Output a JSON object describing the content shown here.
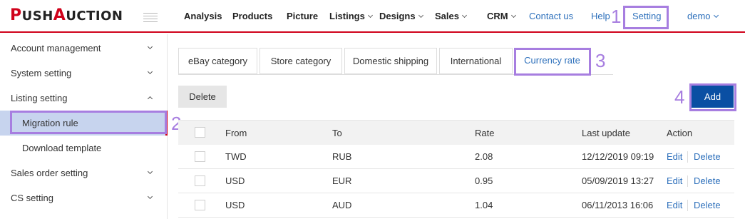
{
  "logo": {
    "p1": "P",
    "p2": "USH",
    "p3": "A",
    "p4": "UCTION"
  },
  "topnav": {
    "analysis": "Analysis",
    "products": "Products",
    "picture": "Picture",
    "listings": "Listings",
    "designs": "Designs",
    "sales": "Sales",
    "crm": "CRM",
    "contact": "Contact us",
    "help": "Help",
    "setting": "Setting",
    "user": "demo"
  },
  "annotations": {
    "n1": "1",
    "n2": "2",
    "n3": "3",
    "n4": "4"
  },
  "sidebar": {
    "account": "Account management",
    "system": "System setting",
    "listing": "Listing setting",
    "migration": "Migration rule",
    "download": "Download template",
    "sales_order": "Sales order setting",
    "cs": "CS setting"
  },
  "tabs": {
    "ebay": "eBay category",
    "store": "Store category",
    "domestic": "Domestic shipping",
    "international": "International",
    "currency": "Currency rate"
  },
  "toolbar": {
    "delete_label": "Delete",
    "add_label": "Add"
  },
  "table": {
    "headers": {
      "from": "From",
      "to": "To",
      "rate": "Rate",
      "last_update": "Last update",
      "action": "Action"
    },
    "rows": [
      {
        "from": "TWD",
        "to": "RUB",
        "rate": "2.08",
        "last_update": "12/12/2019 09:19",
        "edit": "Edit",
        "delete": "Delete"
      },
      {
        "from": "USD",
        "to": "EUR",
        "rate": "0.95",
        "last_update": "05/09/2019 13:27",
        "edit": "Edit",
        "delete": "Delete"
      },
      {
        "from": "USD",
        "to": "AUD",
        "rate": "1.04",
        "last_update": "06/11/2013 16:06",
        "edit": "Edit",
        "delete": "Delete"
      }
    ]
  },
  "colors": {
    "brand_red": "#d0021b",
    "link_blue": "#2c6fbb",
    "add_button": "#0a4fa3",
    "highlight": "#a77ee0"
  }
}
